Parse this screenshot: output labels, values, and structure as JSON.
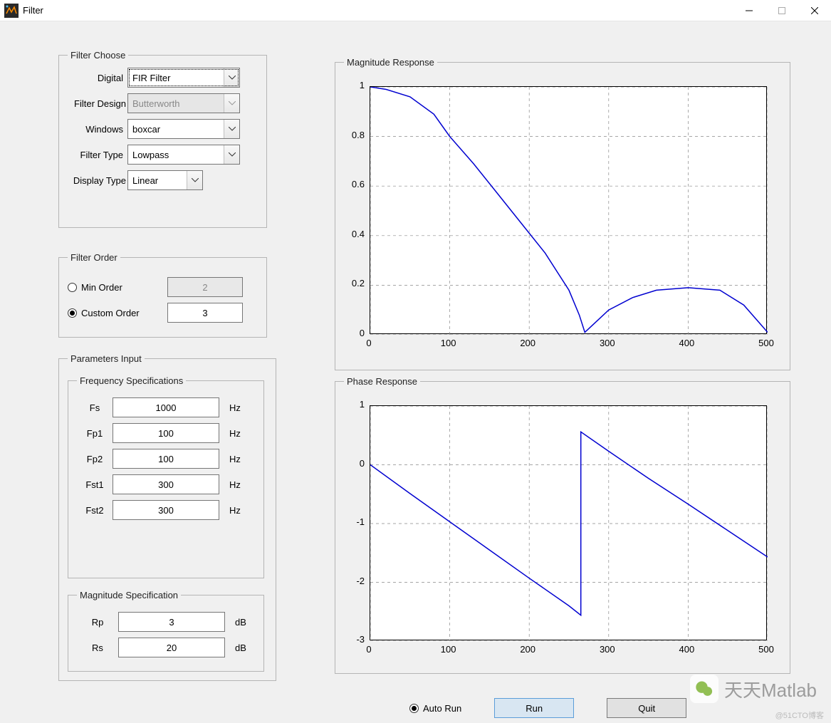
{
  "window": {
    "title": "Filter"
  },
  "filter_choose": {
    "legend": "Filter Choose",
    "rows": {
      "digital": {
        "label": "Digital",
        "value": "FIR Filter"
      },
      "filter_design": {
        "label": "Filter Design",
        "value": "Butterworth"
      },
      "windows": {
        "label": "Windows",
        "value": "boxcar"
      },
      "filter_type": {
        "label": "Filter Type",
        "value": "Lowpass"
      },
      "display_type": {
        "label": "Display Type",
        "value": "Linear"
      }
    }
  },
  "filter_order": {
    "legend": "Filter Order",
    "min_order": {
      "label": "Min Order",
      "value": "2"
    },
    "custom_order": {
      "label": "Custom Order",
      "value": "3"
    }
  },
  "parameters": {
    "legend": "Parameters Input",
    "freq": {
      "legend": "Frequency Specifications",
      "unit": "Hz",
      "fs": {
        "label": "Fs",
        "value": "1000"
      },
      "fp1": {
        "label": "Fp1",
        "value": "100"
      },
      "fp2": {
        "label": "Fp2",
        "value": "100"
      },
      "fst1": {
        "label": "Fst1",
        "value": "300"
      },
      "fst2": {
        "label": "Fst2",
        "value": "300"
      }
    },
    "mag": {
      "legend": "Magnitude Specification",
      "unit": "dB",
      "rp": {
        "label": "Rp",
        "value": "3"
      },
      "rs": {
        "label": "Rs",
        "value": "20"
      }
    }
  },
  "chart_data": [
    {
      "type": "line",
      "title": "Magnitude Response",
      "xlim": [
        0,
        500
      ],
      "ylim": [
        0,
        1
      ],
      "xticks": [
        0,
        100,
        200,
        300,
        400,
        500
      ],
      "yticks": [
        0,
        0.2,
        0.4,
        0.6,
        0.8,
        1
      ],
      "series": [
        {
          "name": "magnitude",
          "color": "#0000d0",
          "x": [
            0,
            20,
            50,
            80,
            100,
            130,
            160,
            190,
            220,
            250,
            263,
            270,
            280,
            300,
            330,
            360,
            400,
            440,
            470,
            500
          ],
          "y": [
            1.0,
            0.99,
            0.96,
            0.89,
            0.8,
            0.69,
            0.57,
            0.45,
            0.33,
            0.18,
            0.08,
            0.01,
            0.04,
            0.1,
            0.15,
            0.18,
            0.19,
            0.18,
            0.12,
            0.01
          ]
        }
      ]
    },
    {
      "type": "line",
      "title": "Phase  Response",
      "xlim": [
        0,
        500
      ],
      "ylim": [
        -3,
        1
      ],
      "xticks": [
        0,
        100,
        200,
        300,
        400,
        500
      ],
      "yticks": [
        -3,
        -2,
        -1,
        0,
        1
      ],
      "series": [
        {
          "name": "phase",
          "color": "#0000d0",
          "x": [
            0,
            50,
            100,
            150,
            200,
            250,
            265,
            265,
            300,
            350,
            400,
            450,
            500
          ],
          "y": [
            0.0,
            -0.49,
            -0.97,
            -1.45,
            -1.93,
            -2.4,
            -2.56,
            0.56,
            0.23,
            -0.23,
            -0.67,
            -1.12,
            -1.57
          ]
        }
      ]
    }
  ],
  "controls": {
    "auto_run": "Auto Run",
    "run": "Run",
    "quit": "Quit"
  },
  "watermark": "天天Matlab",
  "footer_faded": "@51CTO博客"
}
